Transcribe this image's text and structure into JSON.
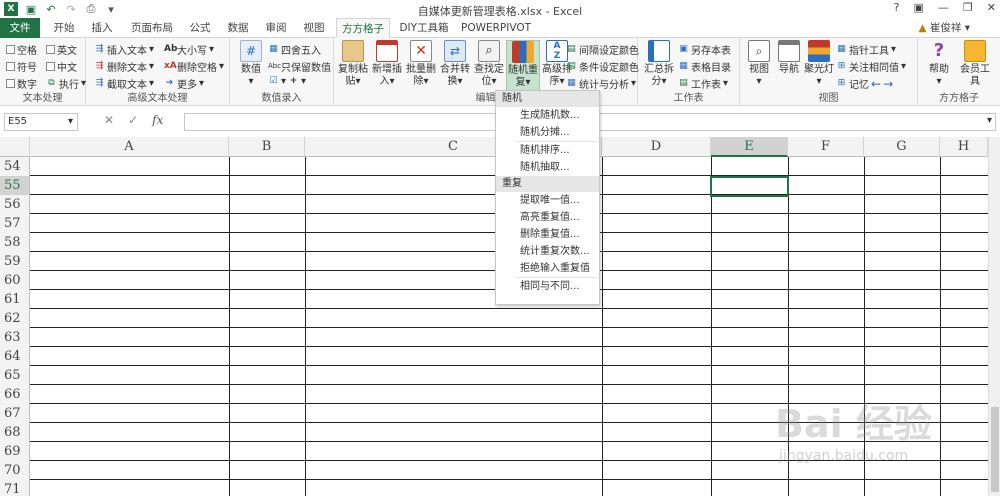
{
  "window_title": "自媒体更新管理表格.xlsx - Excel",
  "user": "崔俊祥",
  "window_controls": [
    "?",
    "▣",
    "—",
    "❐",
    "✕"
  ],
  "tabs": [
    "文件",
    "开始",
    "插入",
    "页面布局",
    "公式",
    "数据",
    "审阅",
    "视图",
    "方方格子",
    "DIY工具箱",
    "POWERPIVOT"
  ],
  "active_tab": "方方格子",
  "ribbon": {
    "text_group": {
      "label": "文本处理",
      "items": [
        "空格",
        "英文",
        "符号",
        "中文",
        "数字",
        "执行"
      ]
    },
    "adv_text": {
      "label": "高级文本处理",
      "items": [
        "插入文本",
        "大小写",
        "删除文本",
        "删除空格",
        "截取文本",
        "更多"
      ]
    },
    "num": {
      "label": "数值录入",
      "items": [
        "数值",
        "四舍五入",
        "只保留数值"
      ]
    },
    "edit": {
      "label": "编辑",
      "buttons": [
        "复制粘贴",
        "新增插入",
        "批量删除",
        "合并转换",
        "查找定位",
        "随机重复",
        "高级排序"
      ],
      "side": [
        "间隔设定颜色",
        "条件设定颜色",
        "统计与分析"
      ]
    },
    "sheet": {
      "label": "工作表",
      "buttons": [
        "汇总拆分"
      ],
      "side": [
        "另存本表",
        "表格目录",
        "工作表"
      ]
    },
    "view": {
      "label": "视图",
      "buttons": [
        "视图",
        "导航",
        "聚光灯"
      ],
      "side": [
        "指针工具",
        "关注相同值",
        "记忆"
      ]
    },
    "ffgz": {
      "label": "方方格子",
      "buttons": [
        "帮助",
        "会员工具"
      ]
    }
  },
  "name_box": "E55",
  "fx_label": "fx",
  "columns": [
    "A",
    "B",
    "C",
    "D",
    "E",
    "F",
    "G",
    "H"
  ],
  "selected_column": "E",
  "rows": [
    "54",
    "55",
    "56",
    "57",
    "58",
    "59",
    "60",
    "61",
    "62",
    "63",
    "64",
    "65",
    "66",
    "67",
    "68",
    "69",
    "70",
    "71"
  ],
  "selected_row": "55",
  "menu": {
    "sections": [
      {
        "header": "随机",
        "items": [
          "生成随机数...",
          "随机分摊...",
          "随机排序...",
          "随机抽取..."
        ]
      },
      {
        "header": "重复",
        "items": [
          "提取唯一值...",
          "高亮重复值...",
          "删除重复值...",
          "统计重复次数...",
          "拒绝输入重复值",
          "相同与不同..."
        ]
      }
    ]
  },
  "watermark": {
    "brand": "Bai 经验",
    "url": "jingyan.baidu.com"
  }
}
